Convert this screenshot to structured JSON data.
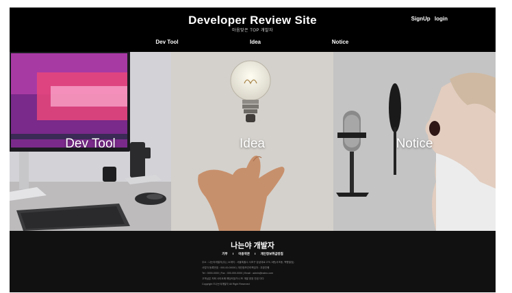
{
  "header": {
    "title": "Developer Review Site",
    "subtitle": "마음맞은 TOP 개발자",
    "signup_label": "SignUp",
    "login_label": "login"
  },
  "nav": {
    "items": [
      {
        "label": "Dev Tool"
      },
      {
        "label": "Idea"
      },
      {
        "label": "Notice"
      }
    ]
  },
  "panels": [
    {
      "label": "Dev Tool"
    },
    {
      "label": "Idea"
    },
    {
      "label": "Notice"
    }
  ],
  "footer": {
    "title": "나는야 개발자",
    "links": [
      "기부",
      "이용약관",
      "개인정보취급방침"
    ],
    "separator": "I",
    "info_lines": [
      "주소 : 나는야개발자(주) | 소재지 : 서울특별시 서초구 강남대로 275, 5층(서초동, 백향빌딩)",
      "사업자 등록번호 : 000-00-00000 | 개인정보관리책임자 : 우완진행",
      "Tel : 0000-0000 | Fax : 000-000-0000 | Email : admin@naleo.com",
      "고객님은 저희 사이트에 해당되었거나 또 개발 양호 안된 다다",
      "Copyright ©나는야개발자 All Right Reserved"
    ]
  }
}
